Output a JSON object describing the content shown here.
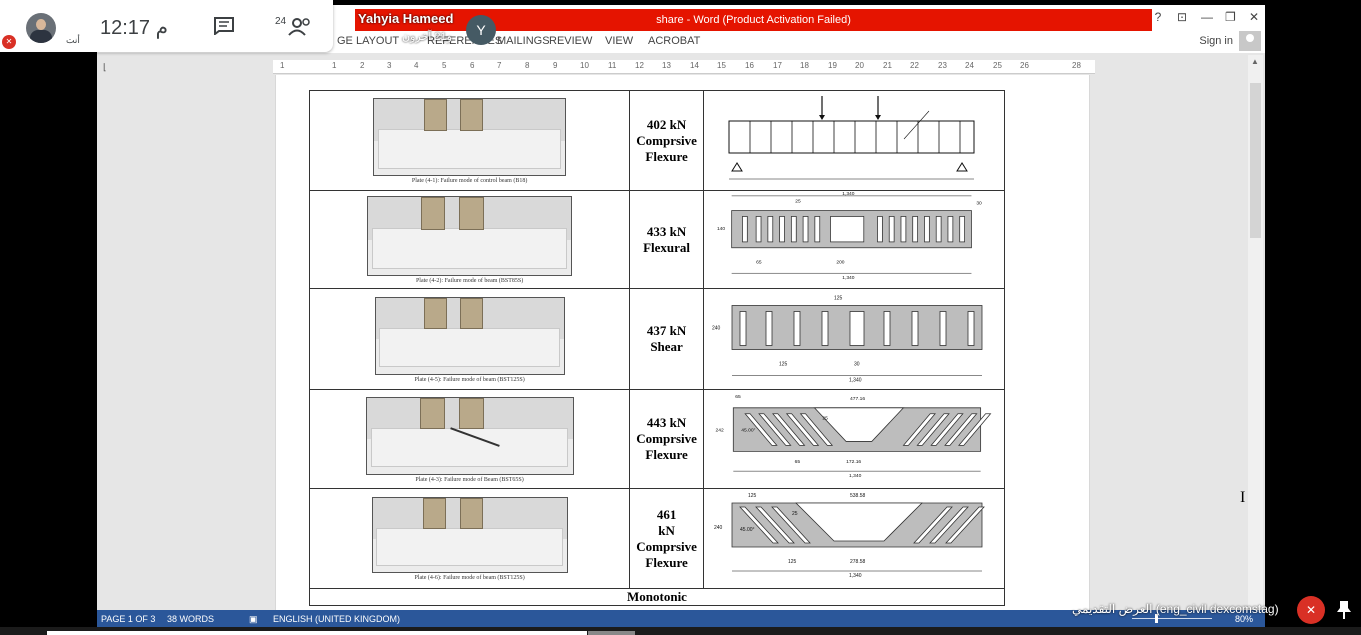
{
  "meet": {
    "time": "12:17 م",
    "participants_count": "24",
    "you_label": "أنت",
    "presenter_name": "Yahyia Hameed",
    "presenter_subtitle": "و21 آخرون",
    "presenter_initial": "Y",
    "presentation_label": "العرض التقديمي (eng_civil dexcomstag)"
  },
  "word": {
    "title": "share - Word (Product Activation Failed)",
    "tabs": [
      "GE LAYOUT",
      "REFERENCES",
      "MAILINGS",
      "REVIEW",
      "VIEW",
      "ACROBAT"
    ],
    "sign_in": "Sign in",
    "window_controls": [
      "?",
      "⊡",
      "—",
      "❐",
      "✕"
    ],
    "ruler_numbers": [
      "1",
      "1",
      "2",
      "3",
      "4",
      "5",
      "6",
      "7",
      "8",
      "9",
      "10",
      "11",
      "12",
      "13",
      "14",
      "15",
      "16",
      "17",
      "18",
      "19",
      "20",
      "21",
      "22",
      "23",
      "24",
      "25",
      "26",
      "28"
    ],
    "status": {
      "page": "PAGE 1 OF 3",
      "words": "38 WORDS",
      "language": "ENGLISH (UNITED KINGDOM)",
      "zoom": "80%"
    }
  },
  "table": {
    "rows": [
      {
        "caption": "Plate (4-1): Failure mode of control beam (B18)",
        "load": "402 kN",
        "mode_1": "Comprsive",
        "mode_2": "Flexure"
      },
      {
        "caption": "Plate (4-2): Failure mode of beam (BST85S)",
        "load": "433 kN",
        "mode_1": "Flexural",
        "mode_2": ""
      },
      {
        "caption": "Plate (4-5): Failure mode of beam (BST125S)",
        "load": "437 kN",
        "mode_1": "Shear",
        "mode_2": ""
      },
      {
        "caption": "Plate (4-3): Failure mode of Beam (BST65S)",
        "load": "443 kN",
        "mode_1": "Comprsive",
        "mode_2": "Flexure"
      },
      {
        "caption": "Plate (4-6): Failure mode of beam (BST125S)",
        "load": "461",
        "load_unit": "kN",
        "mode_1": "Comprsive",
        "mode_2": "Flexure"
      }
    ],
    "footer": "Monotonic",
    "dims": {
      "d_1340": "1,340",
      "d_25": "25",
      "d_30": "30",
      "d_65": "65",
      "d_200": "200",
      "d_125": "125",
      "d_240": "240",
      "d_242": "242",
      "d_477": "477.16",
      "d_45": "45.00°",
      "d_17216": "172.16",
      "d_53858": "538.58",
      "d_27858": "278.58",
      "d_65b": "65",
      "d_140": "140"
    }
  },
  "icons": {
    "chat": "chat-icon",
    "people": "people-icon",
    "mic_off": "mic-off-icon",
    "pin": "pin-icon"
  }
}
